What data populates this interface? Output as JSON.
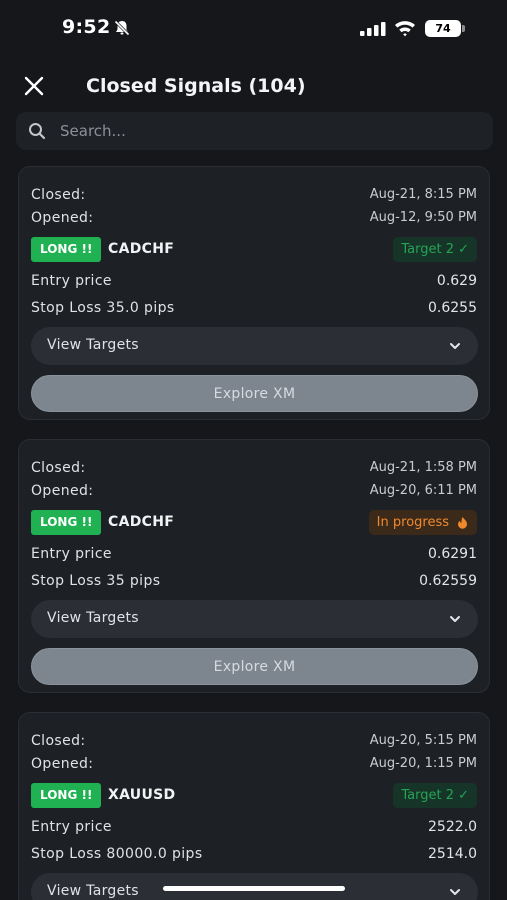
{
  "status_bar": {
    "time": "9:52",
    "battery": "74"
  },
  "header": {
    "title": "Closed Signals (104)"
  },
  "search": {
    "placeholder": "Search..."
  },
  "labels": {
    "closed": "Closed:",
    "opened": "Opened:",
    "entry_price": "Entry price",
    "view_targets": "View Targets",
    "explore": "Explore XM"
  },
  "signals": [
    {
      "closed": "Aug-21, 8:15 PM",
      "opened": "Aug-12, 9:50 PM",
      "direction": "LONG !!",
      "pair": "CADCHF",
      "status": "Target 2 ✓",
      "status_type": "target",
      "entry_price": "0.629",
      "stop_loss_label": "Stop Loss 35.0 pips",
      "stop_loss_value": "0.6255"
    },
    {
      "closed": "Aug-21, 1:58 PM",
      "opened": "Aug-20, 6:11 PM",
      "direction": "LONG !!",
      "pair": "CADCHF",
      "status": "In progress",
      "status_type": "progress",
      "entry_price": "0.6291",
      "stop_loss_label": "Stop Loss 35 pips",
      "stop_loss_value": "0.62559"
    },
    {
      "closed": "Aug-20, 5:15 PM",
      "opened": "Aug-20, 1:15 PM",
      "direction": "LONG !!",
      "pair": "XAUUSD",
      "status": "Target 2 ✓",
      "status_type": "target",
      "entry_price": "2522.0",
      "stop_loss_label": "Stop Loss 80000.0 pips",
      "stop_loss_value": "2514.0"
    }
  ],
  "colors": {
    "background": "#15171b",
    "card": "#1d2024",
    "long_badge": "#1fb152",
    "target_text": "#25a356",
    "progress_text": "#f0892d",
    "explore_button": "#7d858f"
  }
}
